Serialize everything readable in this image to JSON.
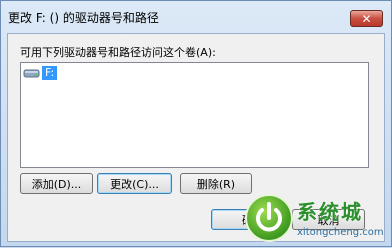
{
  "window": {
    "title": "更改 F: () 的驱动器号和路径",
    "close_glyph": "✕"
  },
  "description": "可用下列驱动器号和路径访问这个卷(A):",
  "list": {
    "items": [
      {
        "label": "F:",
        "icon": "drive-icon",
        "selected": true
      }
    ]
  },
  "buttons": {
    "add": "添加(D)...",
    "change": "更改(C)...",
    "remove": "删除(R)",
    "ok": "确",
    "cancel": "取消"
  },
  "watermark": {
    "brand": "系统城",
    "url": "xitongcheng.com",
    "icon": "power-logo-icon"
  },
  "colors": {
    "selection": "#3399ff",
    "close_button": "#c85042",
    "brand_green": "#2b8f2b"
  }
}
